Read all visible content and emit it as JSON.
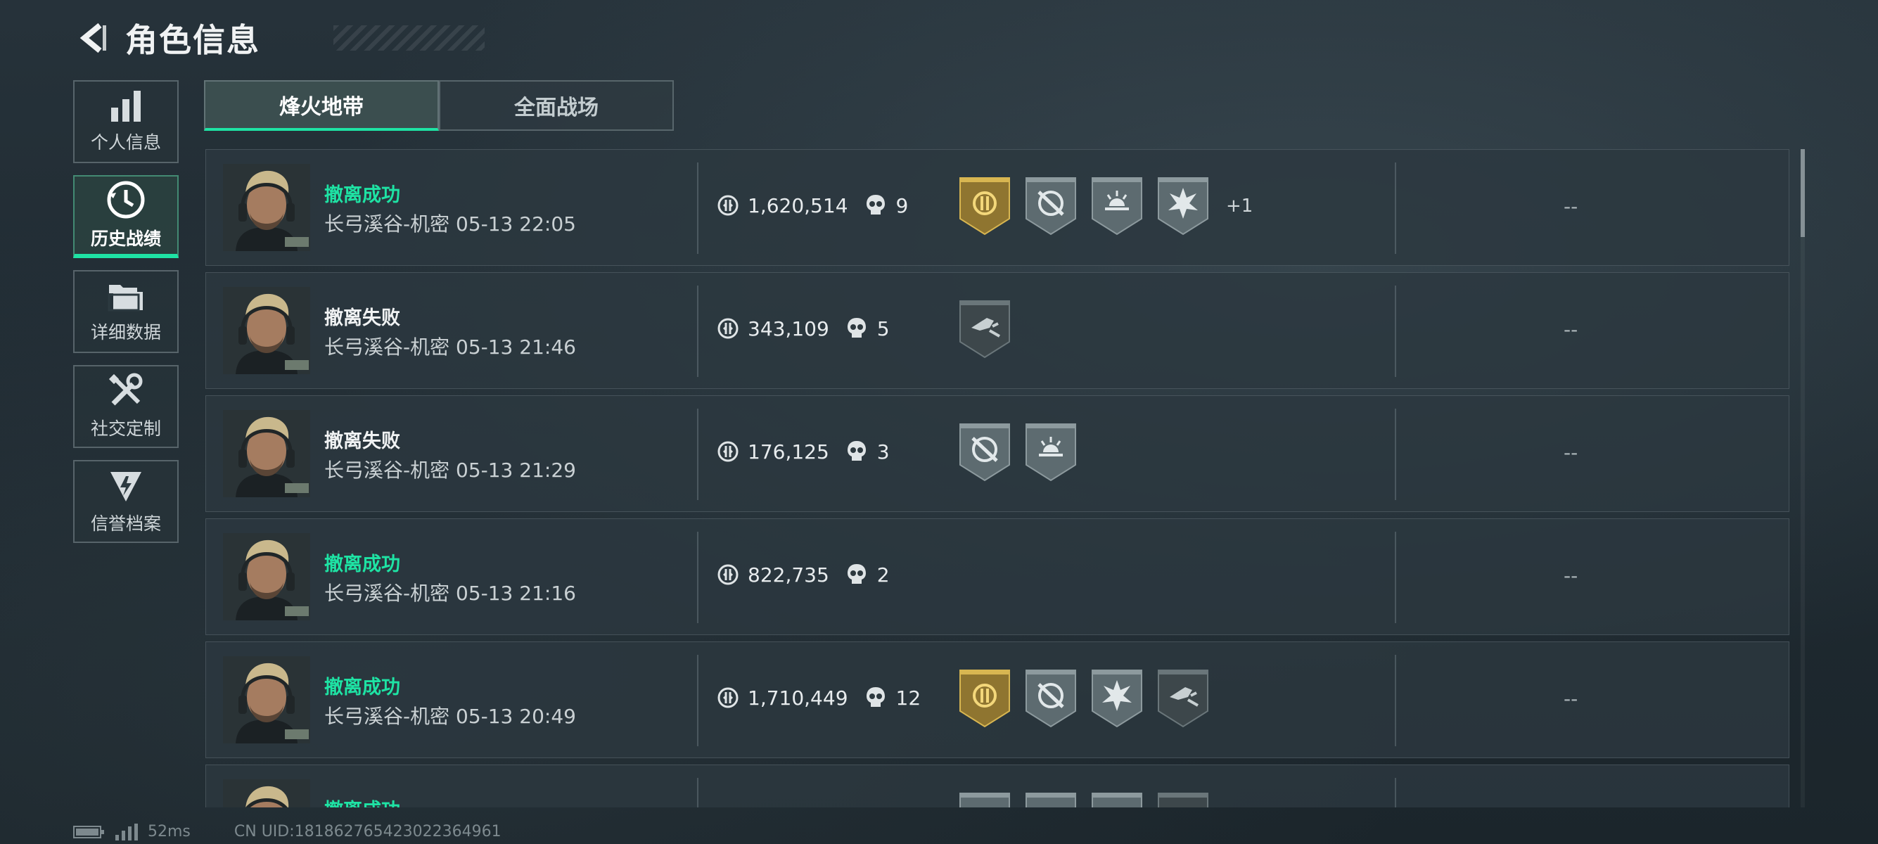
{
  "header": {
    "title": "角色信息"
  },
  "sidenav": [
    {
      "label": "个人信息",
      "icon": "bar-chart-icon"
    },
    {
      "label": "历史战绩",
      "icon": "clock-history-icon",
      "active": true
    },
    {
      "label": "详细数据",
      "icon": "folder-icon"
    },
    {
      "label": "社交定制",
      "icon": "tools-icon"
    },
    {
      "label": "信誉档案",
      "icon": "credit-emblem-icon"
    }
  ],
  "tabs": [
    {
      "label": "烽火地带",
      "active": true
    },
    {
      "label": "全面战场",
      "active": false
    }
  ],
  "matches": [
    {
      "status": "撤离成功",
      "result": "success",
      "map_time": "长弓溪谷-机密 05-13 22:05",
      "value": "1,620,514",
      "kills": "9",
      "badges": [
        "gold-emblem-badge",
        "crosshair-badge",
        "sunrise-badge",
        "explosion-badge"
      ],
      "extra": "+1",
      "right": "--"
    },
    {
      "status": "撤离失败",
      "result": "fail",
      "map_time": "长弓溪谷-机密 05-13 21:46",
      "value": "343,109",
      "kills": "5",
      "badges": [
        "broken-gun-badge"
      ],
      "extra": "",
      "right": "--"
    },
    {
      "status": "撤离失败",
      "result": "fail",
      "map_time": "长弓溪谷-机密 05-13 21:29",
      "value": "176,125",
      "kills": "3",
      "badges": [
        "crosshair-badge",
        "sunrise-badge"
      ],
      "extra": "",
      "right": "--"
    },
    {
      "status": "撤离成功",
      "result": "success",
      "map_time": "长弓溪谷-机密 05-13 21:16",
      "value": "822,735",
      "kills": "2",
      "badges": [],
      "extra": "",
      "right": "--"
    },
    {
      "status": "撤离成功",
      "result": "success",
      "map_time": "长弓溪谷-机密 05-13 20:49",
      "value": "1,710,449",
      "kills": "12",
      "badges": [
        "gold-emblem-badge",
        "crosshair-badge",
        "explosion-badge",
        "broken-gun-badge"
      ],
      "extra": "",
      "right": "--"
    },
    {
      "status": "撤离成功",
      "result": "success",
      "map_time": "",
      "value": "",
      "kills": "",
      "badges": [
        "crosshair-badge",
        "crosshair-badge",
        "sunrise-badge",
        "broken-gun-badge"
      ],
      "extra": "",
      "right": ""
    }
  ],
  "footer": {
    "ping": "52ms",
    "uid": "CN UID:181862765423022364961"
  },
  "colors": {
    "accent": "#1ee3a4",
    "gold": "#c9a544"
  }
}
